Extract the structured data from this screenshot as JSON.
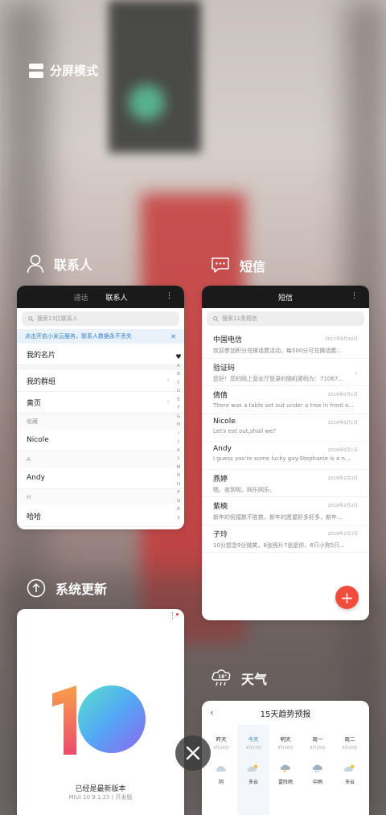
{
  "split_screen": {
    "label": "分屏模式"
  },
  "apps": {
    "contacts": {
      "name": "联系人",
      "tabs": [
        "通话",
        "联系人"
      ],
      "search_placeholder": "搜索13位联系人",
      "banner": "点击开启小米云服务，联系人数据永不丢失",
      "rows": [
        {
          "label": "我的名片"
        },
        {
          "label": "我的群组"
        },
        {
          "label": "黄页"
        }
      ],
      "sections": [
        {
          "header": "收藏",
          "item": "Nicole"
        },
        {
          "header": "A",
          "item": "Andy"
        },
        {
          "header": "H",
          "item": "哈哈"
        }
      ],
      "alphabet": [
        "♥",
        "A",
        "B",
        "C",
        "D",
        "E",
        "F",
        "G",
        "H",
        "I",
        "J",
        "K",
        "L",
        "M",
        "N",
        "O",
        "P",
        "Q",
        "R",
        "S"
      ]
    },
    "sms": {
      "name": "短信",
      "title": "短信",
      "search_placeholder": "搜索11条短信",
      "messages": [
        {
          "name": "中国电信",
          "snippet": "欢迎参加积分兑换话费活动，每500分可兑换话费...",
          "date": "2017年6月30日"
        },
        {
          "name": "验证码",
          "snippet": "您好！您的网上营业厅登录的随机密码为：71067...",
          "date": ""
        },
        {
          "name": "倩倩",
          "snippet": "There was a table set out under a tree in front o...",
          "date": "2019年6月1日"
        },
        {
          "name": "Nicole",
          "snippet": "Let's eat out,shall we?",
          "date": "2019年6月1日"
        },
        {
          "name": "Andy",
          "snippet": "I guess you're some lucky guy:Stephanie is a n...",
          "date": "2019年6月1日"
        },
        {
          "name": "燕婷",
          "snippet": "嗯。收到啦。网乐网乐。",
          "date": "2019年2月2日"
        },
        {
          "name": "紫楠",
          "snippet": "新年的祝福数不胜数，新年的愿望好多好多，新年...",
          "date": "2019年2月2日"
        },
        {
          "name": "子玲",
          "snippet": "10分想念9分微笑，8张照片7张是你，6只小狗5只...",
          "date": "2019年2月2日"
        }
      ],
      "fab_label": "+"
    },
    "updater": {
      "name": "系统更新",
      "status": "已经是最新版本",
      "version": "MIUI 10 9.1.25 | 开发版"
    },
    "weather": {
      "name": "天气",
      "icon_badge": "18°",
      "title": "15天趋势预报",
      "days": [
        {
          "name": "昨天",
          "date": "4月26日",
          "cond": "阴",
          "icon": "cloud-icon"
        },
        {
          "name": "今天",
          "date": "4月27日",
          "cond": "多云",
          "icon": "partly-cloudy-icon"
        },
        {
          "name": "明天",
          "date": "4月28日",
          "cond": "雷阵雨",
          "icon": "thunderstorm-icon"
        },
        {
          "name": "周一",
          "date": "4月29日",
          "cond": "中雨",
          "icon": "rain-icon"
        },
        {
          "name": "周二",
          "date": "4月30日",
          "cond": "多云",
          "icon": "partly-cloudy-icon"
        }
      ]
    }
  },
  "colors": {
    "accent_red": "#f24c3d",
    "link_blue": "#2f7cc7"
  }
}
